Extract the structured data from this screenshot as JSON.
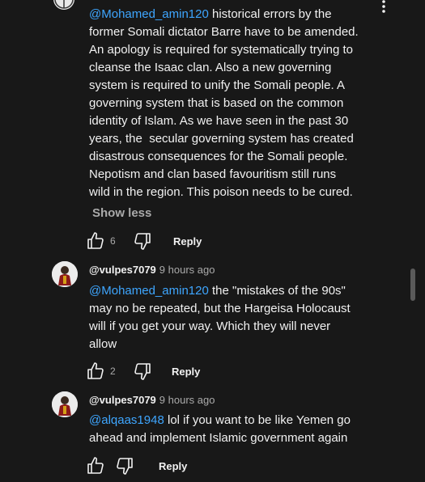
{
  "top_comment": {
    "mention": "@Mohamed_amin120",
    "lines": [
      " historical errors by the",
      "former Somali dictator Barre have to be amended.",
      "An apology is required for systematically trying to",
      "cleanse the Isaac clan. Also a new governing",
      "system is required to unify the Somali people. A",
      "governing system that is based on the common",
      "identity of Islam. As we have seen in the past 30",
      "years, the  secular governing system has created",
      "disastrous consequences for the Somali people.",
      "Nepotism and clan based favouritism still runs",
      "wild in the region. This poison needs to be cured."
    ],
    "show_less_label": "Show less",
    "like_count": "6",
    "reply_label": "Reply",
    "menu_icon": "vertical-ellipsis-icon"
  },
  "replies": [
    {
      "author": "@vulpes7079",
      "time": "9 hours ago",
      "mention": "@Mohamed_amin120",
      "lines": [
        " the \"mistakes of the 90s\"",
        "may no be repeated, but the Hargeisa Holocaust",
        "will if you get your way. Which they will never",
        "allow"
      ],
      "like_count": "2",
      "reply_label": "Reply"
    },
    {
      "author": "@vulpes7079",
      "time": "9 hours ago",
      "mention": "@alqaas1948",
      "lines": [
        " lol if you want to be like Yemen go",
        "ahead and implement Islamic government again"
      ],
      "like_count": "",
      "reply_label": "Reply"
    }
  ],
  "colors": {
    "background": "#181818",
    "mention": "#3ea6ff",
    "secondary_text": "#aaaaaa",
    "primary_text": "#f1f1f1"
  }
}
